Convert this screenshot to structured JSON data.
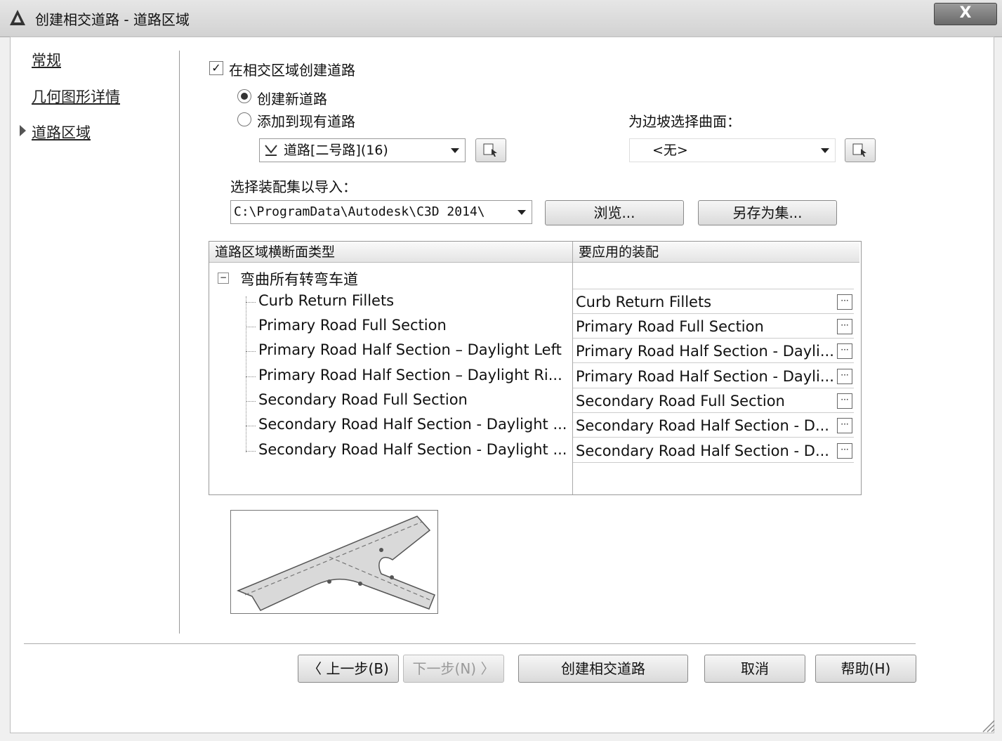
{
  "window": {
    "title": "创建相交道路 - 道路区域",
    "close_label": "X"
  },
  "nav": {
    "items": [
      {
        "label": "常规"
      },
      {
        "label": "几何图形详情"
      },
      {
        "label": "道路区域"
      }
    ]
  },
  "options": {
    "create_in_intersection_label": "在相交区域创建道路",
    "create_in_intersection_checked": true,
    "checkmark": "✓",
    "create_new_label": "创建新道路",
    "add_existing_label": "添加到现有道路",
    "selected_radio": "create_new",
    "corridor_select_value": "道路[二号路](16)",
    "surface_label": "为边坡选择曲面：",
    "surface_select_value": "<无>",
    "assembly_set_label": "选择装配集以导入：",
    "assembly_set_path": "C:\\ProgramData\\Autodesk\\C3D 2014\\",
    "browse_label": "浏览...",
    "save_as_set_label": "另存为集..."
  },
  "grid": {
    "col1_header": "道路区域横断面类型",
    "col2_header": "要应用的装配",
    "group_label": "弯曲所有转弯车道",
    "collapse_glyph": "−",
    "ellipsis_glyph": "···",
    "rows": [
      {
        "type": "Curb Return Fillets",
        "assembly": "Curb Return Fillets"
      },
      {
        "type": "Primary Road Full Section",
        "assembly": "Primary Road Full Section"
      },
      {
        "type": "Primary Road Half Section – Daylight Left",
        "assembly": "Primary Road Half Section - Dayli..."
      },
      {
        "type": "Primary Road Half Section – Daylight Ri...",
        "assembly": "Primary Road Half Section - Dayli..."
      },
      {
        "type": "Secondary Road Full Section",
        "assembly": "Secondary Road Full Section"
      },
      {
        "type": "Secondary Road Half Section - Daylight ...",
        "assembly": "Secondary Road Half Section - D..."
      },
      {
        "type": "Secondary Road Half Section - Daylight ...",
        "assembly": "Secondary Road Half Section - D..."
      }
    ]
  },
  "footer": {
    "back_label": "〈 上一步(B)",
    "next_label": "下一步(N) 〉",
    "create_label": "创建相交道路",
    "cancel_label": "取消",
    "help_label": "帮助(H)"
  }
}
